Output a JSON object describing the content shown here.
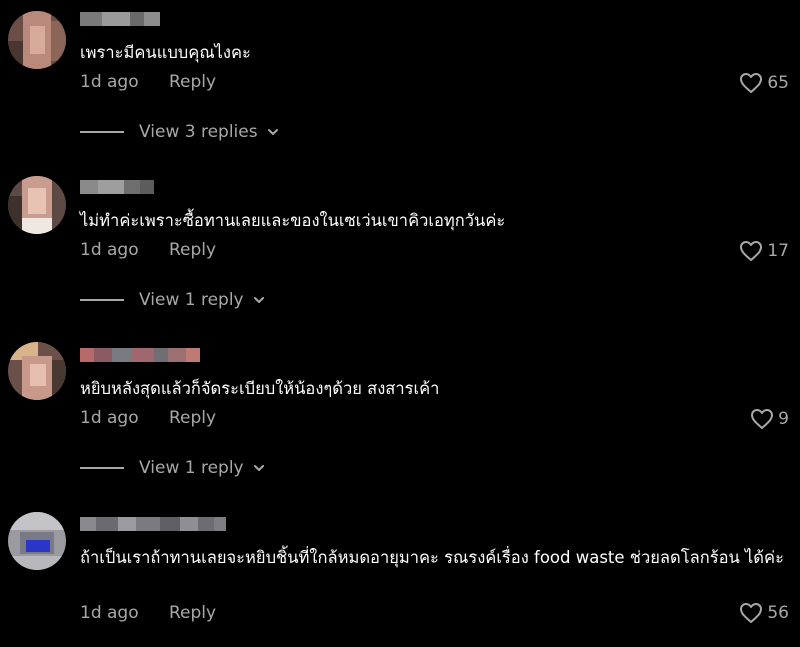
{
  "comments": [
    {
      "text": "เพราะมีคนแบบคุณไงคะ",
      "time": "1d ago",
      "reply_label": "Reply",
      "likes": "65",
      "view_replies": "View 3 replies"
    },
    {
      "text": "ไม่ทำค่ะเพราะซื้อทานเลยและของในเซเว่นเขาคิวเอทุกวันค่ะ",
      "time": "1d ago",
      "reply_label": "Reply",
      "likes": "17",
      "view_replies": "View 1 reply"
    },
    {
      "text": "หยิบหลังสุดแล้วก็จัดระเบียบให้น้องๆด้วย สงสารเค้า",
      "time": "1d ago",
      "reply_label": "Reply",
      "likes": "9",
      "view_replies": "View 1 reply"
    },
    {
      "text": "ถ้าเป็นเราถ้าทานเลยจะหยิบชิ้นที่ใกล้หมดอายุมาคะ รณรงค์เรื่อง food waste ช่วยลดโลกร้อน ได้ค่ะ",
      "time": "1d ago",
      "reply_label": "Reply",
      "likes": "56"
    }
  ],
  "icons": {
    "like": "heart-outline-icon",
    "expand": "chevron-down-icon"
  },
  "colors": {
    "background": "#000000",
    "text": "#ffffff",
    "secondary_text": "#a8a8a8"
  }
}
